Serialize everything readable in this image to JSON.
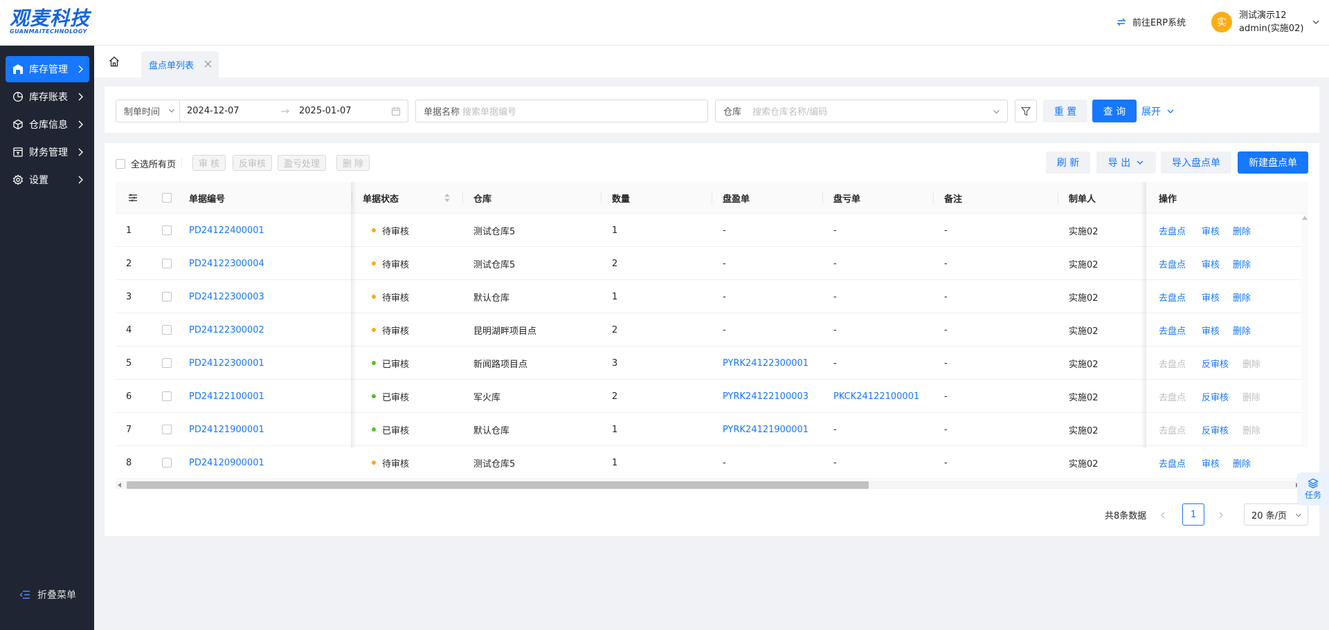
{
  "brand": {
    "logo_main": "观麦科技",
    "logo_sub": "GUANMAITECHNOLOGY",
    "color": "#1664e0"
  },
  "header": {
    "erp_link": "前往ERP系统",
    "user": {
      "avatar": "实",
      "name": "测试演示12",
      "role": "admin(实施02)"
    }
  },
  "sidebar": {
    "items": [
      {
        "label": "库存管理",
        "icon": "warehouse-icon",
        "active": true
      },
      {
        "label": "库存账表",
        "icon": "pie-chart-icon"
      },
      {
        "label": "仓库信息",
        "icon": "cube-icon"
      },
      {
        "label": "财务管理",
        "icon": "ledger-icon"
      },
      {
        "label": "设置",
        "icon": "gear-icon"
      }
    ],
    "collapse_label": "折叠菜单"
  },
  "tabs": {
    "active_tab": "盘点单列表"
  },
  "filters": {
    "time_type": "制单时间",
    "date_start": "2024-12-07",
    "date_end": "2025-01-07",
    "doc_name_label": "单据名称",
    "doc_name_placeholder": "搜索单据编号",
    "warehouse_label": "仓库",
    "warehouse_placeholder": "搜索仓库名称/编码",
    "reset": "重 置",
    "query": "查 询",
    "expand": "展开"
  },
  "toolbar": {
    "select_all": "全选所有页",
    "audit": "审 核",
    "unaudit": "反审核",
    "profit_loss": "盈亏处理",
    "delete": "删 除",
    "refresh": "刷 新",
    "export": "导 出",
    "import": "导入盘点单",
    "create": "新建盘点单"
  },
  "table": {
    "columns": [
      "单据编号",
      "单据状态",
      "仓库",
      "数量",
      "盘盈单",
      "盘亏单",
      "备注",
      "制单人",
      "操作"
    ],
    "rows": [
      {
        "idx": "1",
        "code": "PD24122400001",
        "status": "待审核",
        "status_color": "#faad14",
        "warehouse": "测试仓库5",
        "qty": "1",
        "gain": "-",
        "loss": "-",
        "remark": "-",
        "maker": "实施02",
        "approved": false
      },
      {
        "idx": "2",
        "code": "PD24122300004",
        "status": "待审核",
        "status_color": "#faad14",
        "warehouse": "测试仓库5",
        "qty": "2",
        "gain": "-",
        "loss": "-",
        "remark": "-",
        "maker": "实施02",
        "approved": false
      },
      {
        "idx": "3",
        "code": "PD24122300003",
        "status": "待审核",
        "status_color": "#faad14",
        "warehouse": "默认仓库",
        "qty": "1",
        "gain": "-",
        "loss": "-",
        "remark": "-",
        "maker": "实施02",
        "approved": false
      },
      {
        "idx": "4",
        "code": "PD24122300002",
        "status": "待审核",
        "status_color": "#faad14",
        "warehouse": "昆明湖畔项目点",
        "qty": "2",
        "gain": "-",
        "loss": "-",
        "remark": "-",
        "maker": "实施02",
        "approved": false
      },
      {
        "idx": "5",
        "code": "PD24122300001",
        "status": "已审核",
        "status_color": "#52c41a",
        "warehouse": "新闻路项目点",
        "qty": "3",
        "gain": "PYRK24122300001",
        "loss": "-",
        "remark": "-",
        "maker": "实施02",
        "approved": true
      },
      {
        "idx": "6",
        "code": "PD24122100001",
        "status": "已审核",
        "status_color": "#52c41a",
        "warehouse": "军火库",
        "qty": "2",
        "gain": "PYRK24122100003",
        "loss": "PKCK24122100001",
        "remark": "-",
        "maker": "实施02",
        "approved": true
      },
      {
        "idx": "7",
        "code": "PD24121900001",
        "status": "已审核",
        "status_color": "#52c41a",
        "warehouse": "默认仓库",
        "qty": "1",
        "gain": "PYRK24121900001",
        "loss": "-",
        "remark": "-",
        "maker": "实施02",
        "approved": true
      },
      {
        "idx": "8",
        "code": "PD24120900001",
        "status": "待审核",
        "status_color": "#faad14",
        "warehouse": "测试仓库5",
        "qty": "1",
        "gain": "-",
        "loss": "-",
        "remark": "-",
        "maker": "实施02",
        "approved": false
      }
    ],
    "actions": {
      "count": "去盘点",
      "audit": "审核",
      "unaudit": "反审核",
      "delete": "删除"
    }
  },
  "pagination": {
    "total": "共8条数据",
    "current": "1",
    "page_size": "20 条/页"
  },
  "float": {
    "task": "任务"
  }
}
